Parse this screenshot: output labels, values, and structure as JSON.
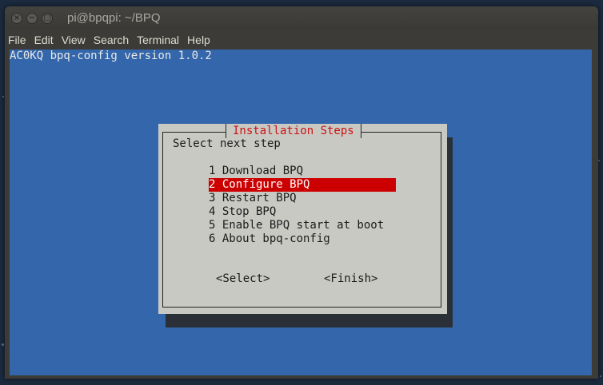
{
  "window": {
    "title": "pi@bpqpi: ~/BPQ",
    "controls": {
      "close": "×",
      "minimize": "−",
      "maximize": "□"
    }
  },
  "menubar": [
    "File",
    "Edit",
    "View",
    "Search",
    "Terminal",
    "Help"
  ],
  "terminal": {
    "header": "AC0KQ bpq-config version 1.0.2",
    "background": "#3366aa"
  },
  "dialog": {
    "title": "Installation Steps",
    "prompt": "Select next step",
    "options": [
      {
        "label": "1 Download BPQ"
      },
      {
        "label": "2 Configure BPQ"
      },
      {
        "label": "3 Restart BPQ"
      },
      {
        "label": "4 Stop BPQ"
      },
      {
        "label": "5 Enable BPQ start at boot"
      },
      {
        "label": "6 About bpq-config"
      }
    ],
    "selected_index": 1,
    "buttons": {
      "select": "<Select>",
      "finish": "<Finish>"
    },
    "colors": {
      "title": "#cc1111",
      "highlight": "#cc0000",
      "panel": "#c9c9c4"
    }
  }
}
